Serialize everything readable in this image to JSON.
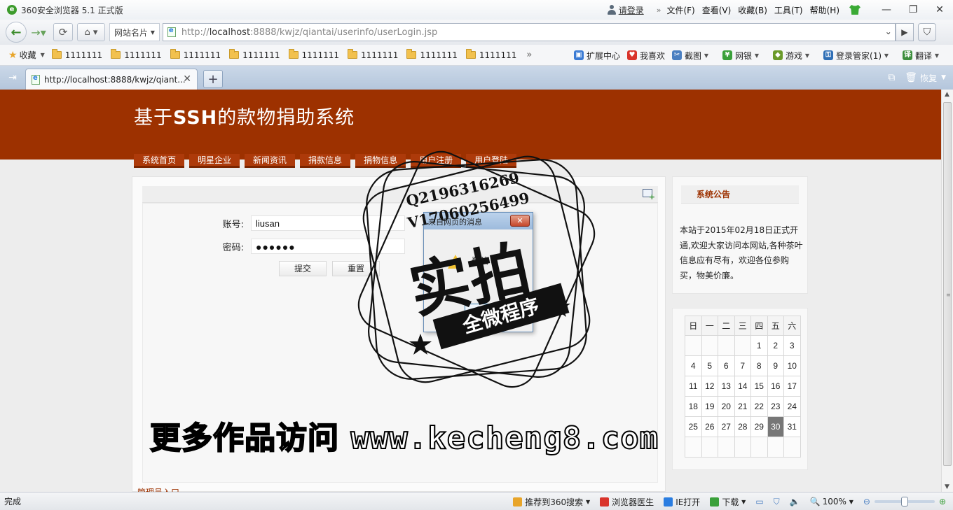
{
  "window": {
    "title": "360安全浏览器 5.1 正式版",
    "login_link": "请登录",
    "menu": [
      "文件(F)",
      "查看(V)",
      "收藏(B)",
      "工具(T)",
      "帮助(H)"
    ]
  },
  "navbar": {
    "site_name": "网站名片",
    "url_prefix": "http://",
    "url_host": "localhost",
    "url_rest": ":8888/kwjz/qiantai/userinfo/userLogin.jsp"
  },
  "favorites": {
    "label": "收藏",
    "folders": [
      "1111111",
      "1111111",
      "1111111",
      "1111111",
      "1111111",
      "1111111",
      "1111111",
      "1111111"
    ],
    "tools": [
      "扩展中心",
      "我喜欢",
      "截图",
      "网银",
      "游戏",
      "登录管家(1)",
      "翻译"
    ]
  },
  "tabs": {
    "active_title": "http://localhost:8888/kwjz/qiant...",
    "restore_label": "恢复"
  },
  "site": {
    "title_prefix": "基于",
    "title_bold": "SSH",
    "title_suffix": "的款物捐助系统",
    "nav": [
      "系统首页",
      "明星企业",
      "新闻资讯",
      "捐款信息",
      "捐物信息",
      "用户注册",
      "用户登陆"
    ]
  },
  "login_form": {
    "account_label": "账号:",
    "account_value": "liusan",
    "password_label": "密码:",
    "password_value": "●●●●●●",
    "submit_label": "提交",
    "reset_label": "重置",
    "admin_link": "管理员入口"
  },
  "notice": {
    "title": "系统公告",
    "text": "本站于2015年02月18日正式开通,欢迎大家访问本网站,各种茶叶信息应有尽有，欢迎各位参购买，物美价廉。"
  },
  "calendar": {
    "weekdays": [
      "日",
      "一",
      "二",
      "三",
      "四",
      "五",
      "六"
    ],
    "weeks": [
      [
        "",
        "",
        "",
        "",
        "1",
        "2",
        "3"
      ],
      [
        "4",
        "5",
        "6",
        "7",
        "8",
        "9",
        "10"
      ],
      [
        "11",
        "12",
        "13",
        "14",
        "15",
        "16",
        "17"
      ],
      [
        "18",
        "19",
        "20",
        "21",
        "22",
        "23",
        "24"
      ],
      [
        "25",
        "26",
        "27",
        "28",
        "29",
        "30",
        "31"
      ],
      [
        "",
        "",
        "",
        "",
        "",
        "",
        ""
      ]
    ],
    "today": "30"
  },
  "dialog": {
    "title": "来自网页的消息",
    "message": "登陆",
    "ok_label": "确定"
  },
  "watermark": {
    "qq1": "Q2196316269",
    "qq2": "V17060256499",
    "big": "实拍",
    "ribbon": "全微程序",
    "site_prefix": "更多作品访问",
    "site_url": "www.kecheng8.com"
  },
  "statusbar": {
    "status": "完成",
    "items": [
      "推荐到360搜索",
      "浏览器医生",
      "IE打开",
      "下载"
    ],
    "zoom": "100%"
  }
}
